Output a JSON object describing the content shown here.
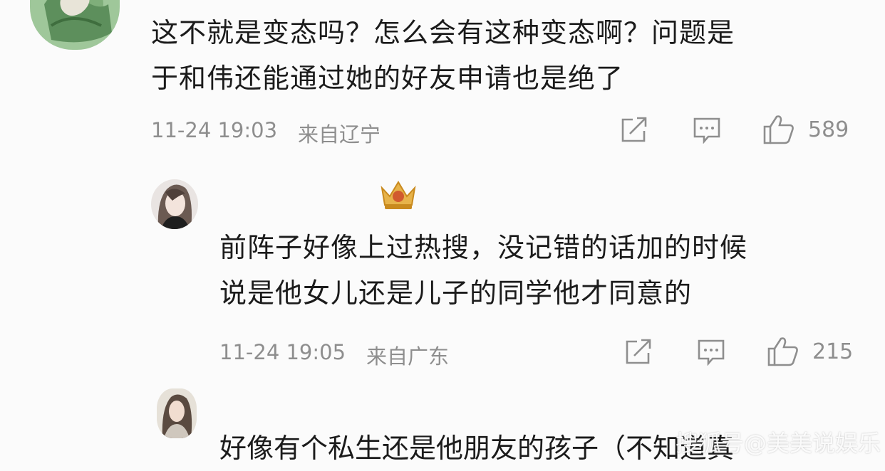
{
  "comments": [
    {
      "lines": [
        "这不就是变态吗？怎么会有这种变态啊？问题是",
        "于和伟还能通过她的好友申请也是绝了"
      ],
      "timestamp": "11-24 19:03",
      "location": "来自辽宁",
      "likes": "589"
    },
    {
      "lines": [
        "前阵子好像上过热搜，没记错的话加的时候",
        "说是他女儿还是儿子的同学他才同意的"
      ],
      "timestamp": "11-24 19:05",
      "location": "来自广东",
      "likes": "215"
    },
    {
      "lines": [
        "好像有个私生还是他朋友的孩子（不知道真"
      ]
    }
  ],
  "icons": {
    "share": "share-icon",
    "comment": "comment-icon",
    "like": "thumbs-up-icon",
    "badge": "crown-badge-icon"
  },
  "watermark": "搜狐号@美美说娱乐"
}
